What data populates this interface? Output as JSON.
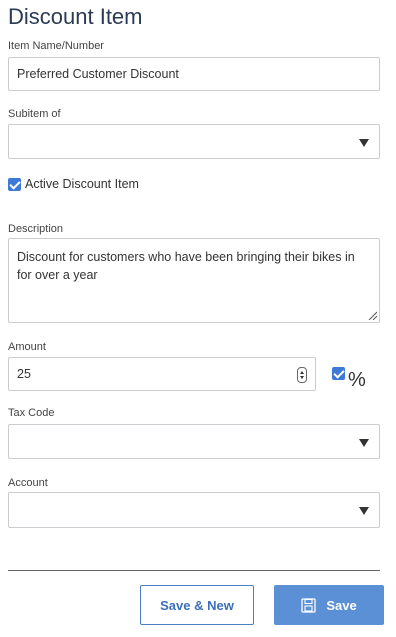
{
  "page": {
    "title": "Discount Item"
  },
  "fields": {
    "item_name": {
      "label": "Item Name/Number",
      "value": "Preferred Customer Discount"
    },
    "subitem_of": {
      "label": "Subitem of",
      "value": ""
    },
    "active": {
      "label": "Active Discount Item",
      "checked": true
    },
    "description": {
      "label": "Description",
      "value": "Discount for customers who have been bringing their bikes in for over a year"
    },
    "amount": {
      "label": "Amount",
      "value": "25",
      "percent_checked": true,
      "percent_symbol": "%"
    },
    "tax_code": {
      "label": "Tax Code",
      "value": ""
    },
    "account": {
      "label": "Account",
      "value": ""
    }
  },
  "buttons": {
    "save_new": "Save & New",
    "save": "Save"
  },
  "colors": {
    "accent": "#5b8fd6",
    "title": "#2b3a55",
    "checkbox": "#3d7ad8"
  },
  "icons": {
    "save": "save-icon",
    "dropdown": "chevron-down-icon",
    "spinner": "spinner-icon",
    "resize": "resize-grip-icon"
  }
}
